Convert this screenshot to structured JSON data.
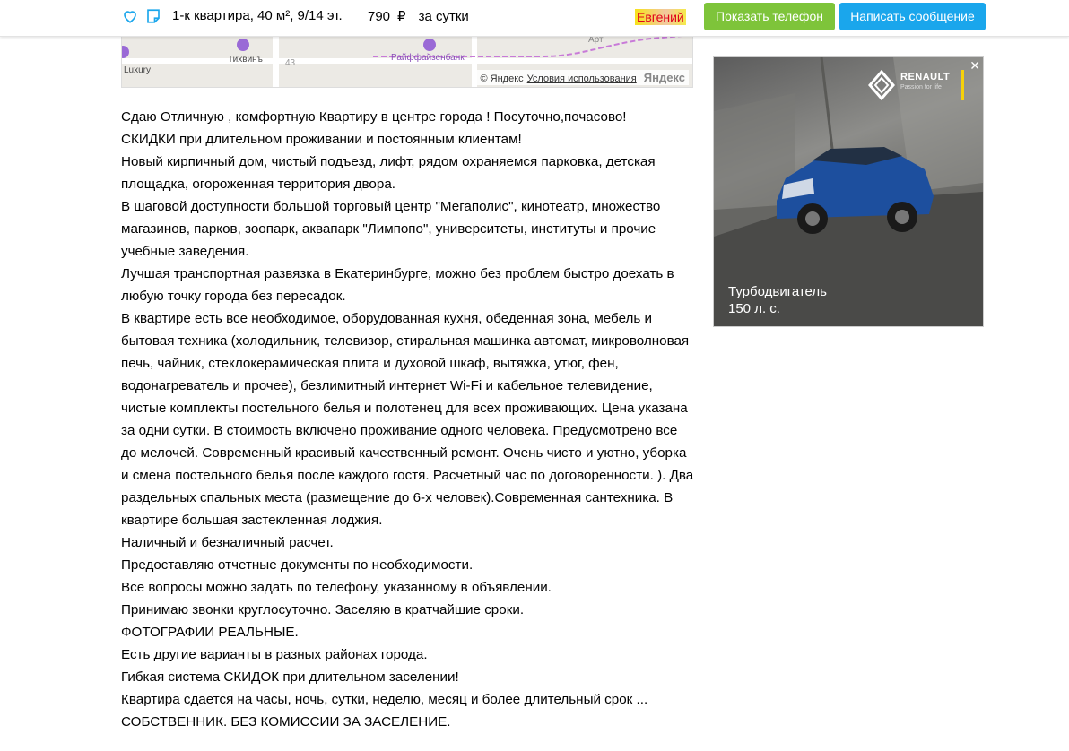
{
  "header": {
    "title": "1-к квартира, 40 м², 9/14 эт.",
    "price_value": "790",
    "price_currency": "₽",
    "price_period": "за сутки",
    "seller_name": "Евгений",
    "show_phone_label": "Показать телефон",
    "write_message_label": "Написать сообщение",
    "icons": [
      "heart-icon",
      "note-icon"
    ],
    "colors": {
      "green": "#7ec43a",
      "blue": "#1aa6ec"
    }
  },
  "map": {
    "labels": [
      "Luxury",
      "Тихвинъ",
      "43",
      "Райффайзенбанк",
      "Арт"
    ],
    "copyright": "© Яндекс",
    "terms_link": "Условия использования",
    "logo": "Яндекс"
  },
  "description": [
    "Сдаю Отличную , комфортную Квартиру в центре города ! Посуточно,почасово!",
    "СКИДКИ при длительном проживании и постоянным клиентам!",
    "Новый кирпичный дом, чистый подъезд, лифт, рядом охраняемся парковка, детская площадка, огороженная территория двора.",
    "В шаговой доступности большой торговый центр \"Мегаполис\", кинотеатр, множество магазинов, парков, зоопарк, аквапарк \"Лимпопо\", университеты, институты и прочие учебные заведения.",
    "Лучшая транспортная развязка в Екатеринбурге, можно без проблем быстро доехать в любую точку города без пересадок.",
    "В квартире есть все необходимое, оборудованная кухня, обеденная зона, мебель и бытовая техника (холодильник, телевизор, стиральная машинка автомат, микроволновая печь, чайник, стеклокерамическая плита и духовой шкаф, вытяжка, утюг, фен, водонагреватель и прочее), безлимитный интернет Wi-Fi и кабельное телевидение, чистые комплекты постельного белья и полотенец для всех проживающих. Цена указана за одни сутки. В стоимость включено проживание одного человека. Предусмотрено все до мелочей. Современный красивый качественный ремонт. Очень чисто и уютно, уборка и смена постельного белья после каждого гостя. Расчетный час по договоренности. ). Два раздельных спальных места (размещение до 6-х человек).Современная сантехника. В квартире большая застекленная лоджия.",
    "Наличный и безналичный расчет.",
    "Предоставляю отчетные документы по необходимости.",
    "Все вопросы можно задать по телефону, указанному в объявлении.",
    "Принимаю звонки круглосуточно. Заселяю в кратчайшие сроки.",
    "ФОТОГРАФИИ РЕАЛЬНЫЕ.",
    "Есть другие варианты в разных районах города.",
    "Гибкая система СКИДОК при длительном заселении!",
    "Квартира сдается на часы, ночь, сутки, неделю, месяц и более длительный срок ...",
    "СОБСТВЕННИК. БЕЗ КОМИССИИ ЗА ЗАСЕЛЕНИЕ."
  ],
  "ad": {
    "brand": "RENAULT",
    "slogan": "Passion for life",
    "caption_line1": "Турбодвигатель",
    "caption_line2": "150 л. с.",
    "close_symbol": "✕"
  }
}
